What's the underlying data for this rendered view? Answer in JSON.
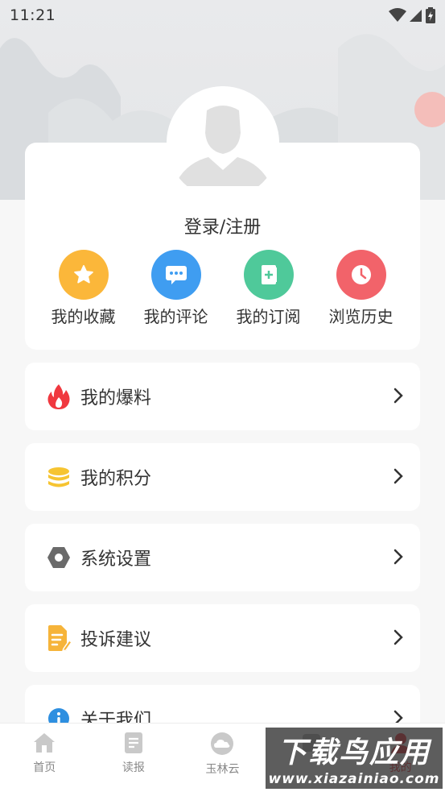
{
  "status_bar": {
    "time": "11:21"
  },
  "profile": {
    "login_label": "登录/注册"
  },
  "quick_actions": [
    {
      "label": "我的收藏",
      "icon": "star-icon",
      "color": "#fbb73a"
    },
    {
      "label": "我的评论",
      "icon": "comment-icon",
      "color": "#3f9df1"
    },
    {
      "label": "我的订阅",
      "icon": "subscribe-icon",
      "color": "#4fc99a"
    },
    {
      "label": "浏览历史",
      "icon": "clock-icon",
      "color": "#f2636a"
    }
  ],
  "menu": [
    {
      "label": "我的爆料",
      "icon": "fire-icon"
    },
    {
      "label": "我的积分",
      "icon": "coins-icon"
    },
    {
      "label": "系统设置",
      "icon": "settings-icon"
    },
    {
      "label": "投诉建议",
      "icon": "feedback-icon"
    },
    {
      "label": "关于我们",
      "icon": "info-icon"
    }
  ],
  "bottom_nav": [
    {
      "label": "首页",
      "icon": "home-icon"
    },
    {
      "label": "读报",
      "icon": "newspaper-icon"
    },
    {
      "label": "玉林云",
      "icon": "cloud-icon"
    },
    {
      "label": "",
      "icon": "service-icon"
    },
    {
      "label": "我的",
      "icon": "profile-icon"
    }
  ],
  "watermark": {
    "main": "下载鸟应用",
    "sub": "www.xiazainiao.com"
  }
}
